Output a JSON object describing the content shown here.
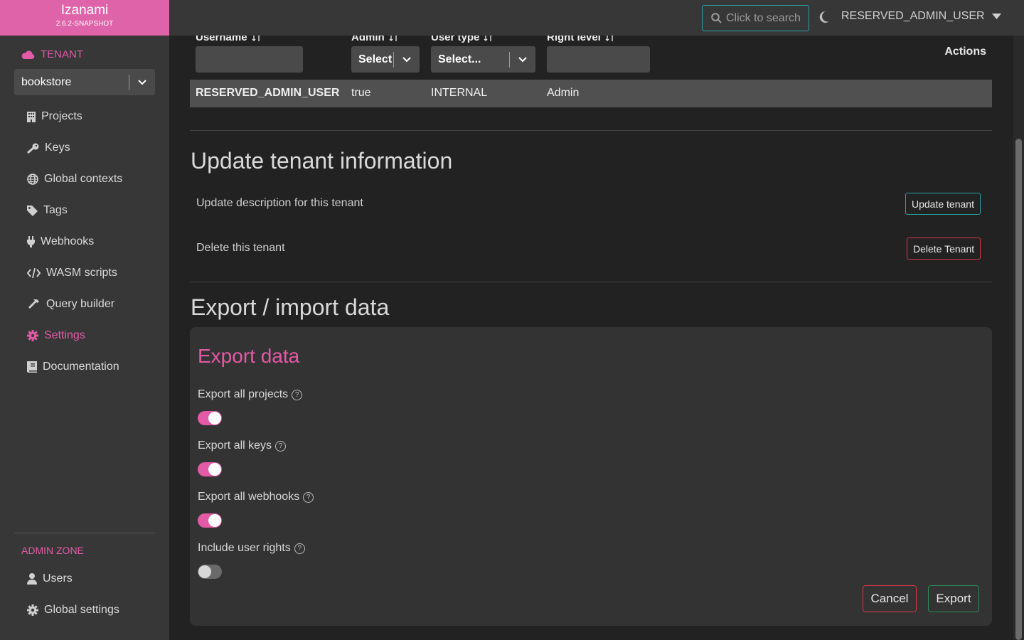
{
  "brand": {
    "name": "Izanami",
    "version": "2.6.2-SNAPSHOT"
  },
  "sidebar": {
    "tenant_header": "TENANT",
    "tenant_value": "bookstore",
    "items": [
      {
        "label": "Projects",
        "icon": "building-icon"
      },
      {
        "label": "Keys",
        "icon": "key-icon"
      },
      {
        "label": "Global contexts",
        "icon": "globe-icon"
      },
      {
        "label": "Tags",
        "icon": "tag-icon"
      },
      {
        "label": "Webhooks",
        "icon": "plug-icon"
      },
      {
        "label": "WASM scripts",
        "icon": "code-icon"
      },
      {
        "label": "Query builder",
        "icon": "hammer-icon"
      },
      {
        "label": "Settings",
        "icon": "gear-icon",
        "active": true
      },
      {
        "label": "Documentation",
        "icon": "book-icon"
      }
    ],
    "admin_zone": "ADMIN ZONE",
    "admin_items": [
      {
        "label": "Users",
        "icon": "user-icon"
      },
      {
        "label": "Global settings",
        "icon": "gear-icon"
      }
    ]
  },
  "topbar": {
    "search_label": "Click to search",
    "user": "RESERVED_ADMIN_USER"
  },
  "users_table": {
    "headers": [
      "Username",
      "Admin",
      "User type",
      "Right level",
      "Actions"
    ],
    "admin_filter": "Select",
    "type_filter": "Select...",
    "rows": [
      [
        "RESERVED_ADMIN_USER",
        "true",
        "INTERNAL",
        "Admin"
      ]
    ]
  },
  "update_section": {
    "title": "Update tenant information",
    "description_label": "Update description for this tenant",
    "update_button": "Update tenant",
    "delete_label": "Delete this tenant",
    "delete_button": "Delete Tenant"
  },
  "export_section": {
    "title": "Export / import data",
    "card_title": "Export data",
    "options": [
      {
        "label": "Export all projects",
        "on": true
      },
      {
        "label": "Export all keys",
        "on": true
      },
      {
        "label": "Export all webhooks",
        "on": true
      },
      {
        "label": "Include user rights",
        "on": false
      }
    ],
    "cancel": "Cancel",
    "export": "Export"
  },
  "colors": {
    "accent": "#e35aa6",
    "brand": "#de63a8",
    "teal": "#2aa0a6",
    "danger": "#d9364a",
    "success": "#2d8a5a"
  }
}
